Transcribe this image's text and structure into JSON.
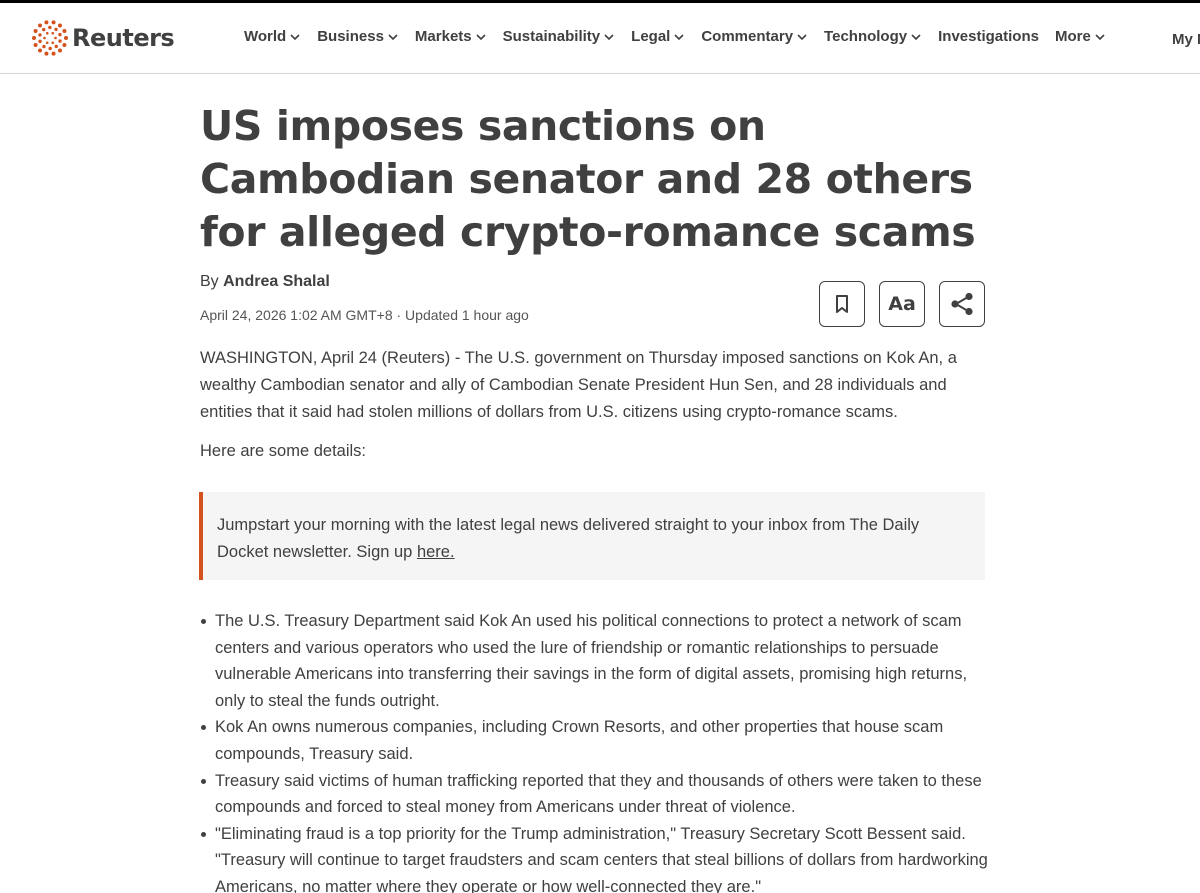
{
  "header": {
    "logo_text": "Reuters",
    "brand_color": "#d4521b",
    "nav": [
      {
        "label": "World",
        "has_dropdown": true
      },
      {
        "label": "Business",
        "has_dropdown": true
      },
      {
        "label": "Markets",
        "has_dropdown": true
      },
      {
        "label": "Sustainability",
        "has_dropdown": true
      },
      {
        "label": "Legal",
        "has_dropdown": true
      },
      {
        "label": "Commentary",
        "has_dropdown": true
      },
      {
        "label": "Technology",
        "has_dropdown": true
      },
      {
        "label": "Investigations",
        "has_dropdown": false
      },
      {
        "label": "More",
        "has_dropdown": true
      }
    ],
    "my_news_label": "My N"
  },
  "article": {
    "title": "US imposes sanctions on Cambodian senator and 28 others for alleged crypto-romance scams",
    "byline_prefix": "By",
    "author": "Andrea Shalal",
    "dateline": "April 24, 2026 1:02 AM GMT+8 · Updated 1 hour ago",
    "tools": {
      "bookmark_icon": "bookmark-icon",
      "text_size_label": "Aa",
      "share_icon": "share-icon"
    },
    "lead_paragraph": "WASHINGTON, April 24 (Reuters) - The U.S. government on Thursday imposed sanctions on Kok An, a wealthy Cambodian senator and ally of Cambodian Senate President Hun Sen, and 28 individuals and entities that it said had stolen millions of dollars from U.S. citizens using crypto-romance scams.",
    "details_intro": "Here are some details:",
    "callout": {
      "text": "Jumpstart your morning with the latest legal news delivered straight to your inbox from The Daily Docket newsletter. Sign up ",
      "link_text": "here."
    },
    "bullets": [
      "The U.S. Treasury Department said Kok An used his political connections to protect a network of scam centers and various operators who used the lure of friendship or romantic relationships to persuade vulnerable Americans into transferring their savings in the form of digital assets, promising high returns, only to steal the funds outright.",
      "Kok An owns numerous companies, including Crown Resorts, and other properties that house scam compounds, Treasury said.",
      "Treasury said victims of human trafficking reported that they and thousands of others were taken to these compounds and forced to steal money from Americans under threat of violence.",
      "\"Eliminating fraud is a top priority for the Trump administration,\" Treasury Secretary Scott Bessent said. \"Treasury will continue to target fraudsters and scam centers that steal billions of dollars from hardworking Americans, no matter where they operate or how well-connected they are.\""
    ]
  }
}
